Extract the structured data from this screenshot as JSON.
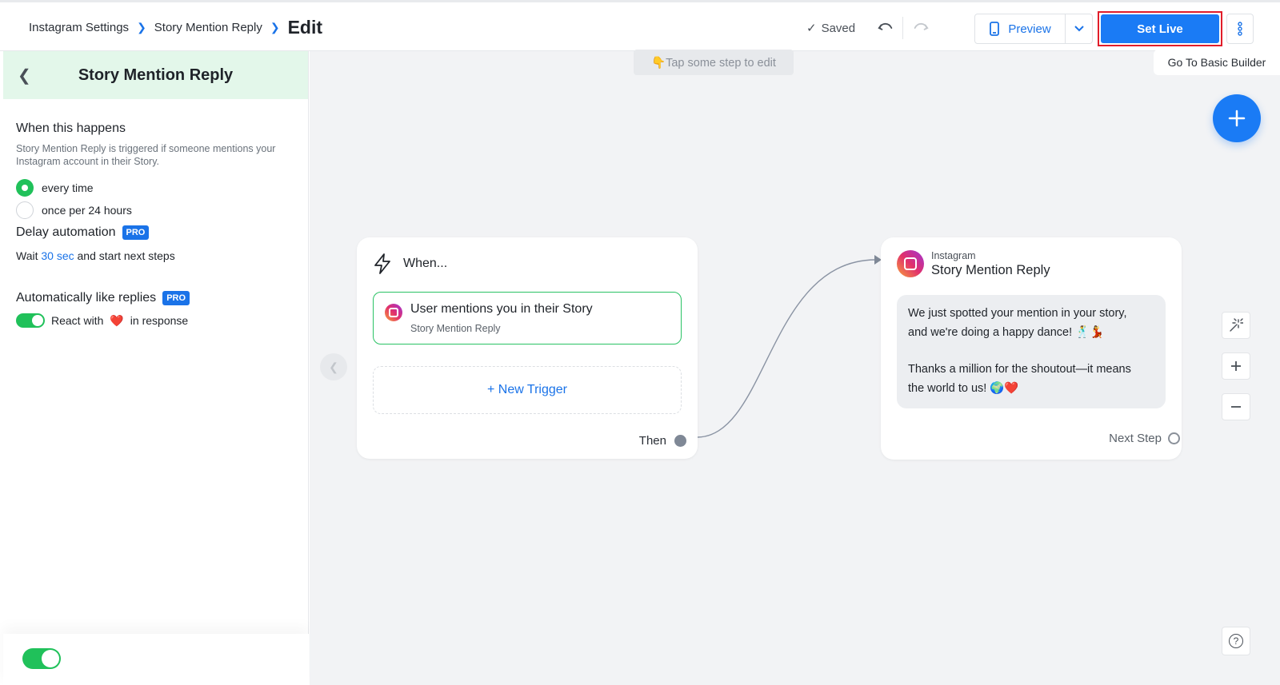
{
  "breadcrumb": {
    "items": [
      "Instagram Settings",
      "Story Mention Reply"
    ],
    "current": "Edit"
  },
  "toolbar": {
    "saved_label": "Saved",
    "preview_label": "Preview",
    "set_live_label": "Set Live"
  },
  "sidebar": {
    "title": "Story Mention Reply",
    "when_title": "When this happens",
    "when_desc": "Story Mention Reply is triggered if someone mentions your Instagram account in their Story.",
    "options": [
      {
        "label": "every time",
        "selected": true
      },
      {
        "label": "once per 24 hours",
        "selected": false
      }
    ],
    "delay": {
      "title": "Delay automation",
      "badge": "PRO",
      "wait_prefix": "Wait",
      "wait_value": "30 sec",
      "wait_suffix": "and start next steps"
    },
    "autolike": {
      "title": "Automatically like replies",
      "badge": "PRO",
      "react_prefix": "React with",
      "react_emoji": "❤️",
      "react_suffix": "in response",
      "enabled": true
    },
    "footer_enabled": true
  },
  "canvas": {
    "tip": "👇Tap some step to edit",
    "basic_builder": "Go To Basic Builder",
    "when_card": {
      "title": "When...",
      "trigger_title": "User mentions you in their Story",
      "trigger_sub": "Story Mention Reply",
      "new_trigger": "+ New Trigger",
      "then_label": "Then"
    },
    "message_card": {
      "app": "Instagram",
      "title": "Story Mention Reply",
      "line1": "We just spotted your mention in your story,",
      "line2": "and we're doing a happy dance! 🕺💃",
      "line3": "Thanks a million for the shoutout—it means",
      "line4": "the world to us! 🌍❤️",
      "next_label": "Next Step"
    }
  },
  "colors": {
    "accent": "#1a7bf5",
    "success": "#20c15a",
    "highlight_border": "#e11d2a",
    "sidebar_header": "#e3f7ea"
  }
}
